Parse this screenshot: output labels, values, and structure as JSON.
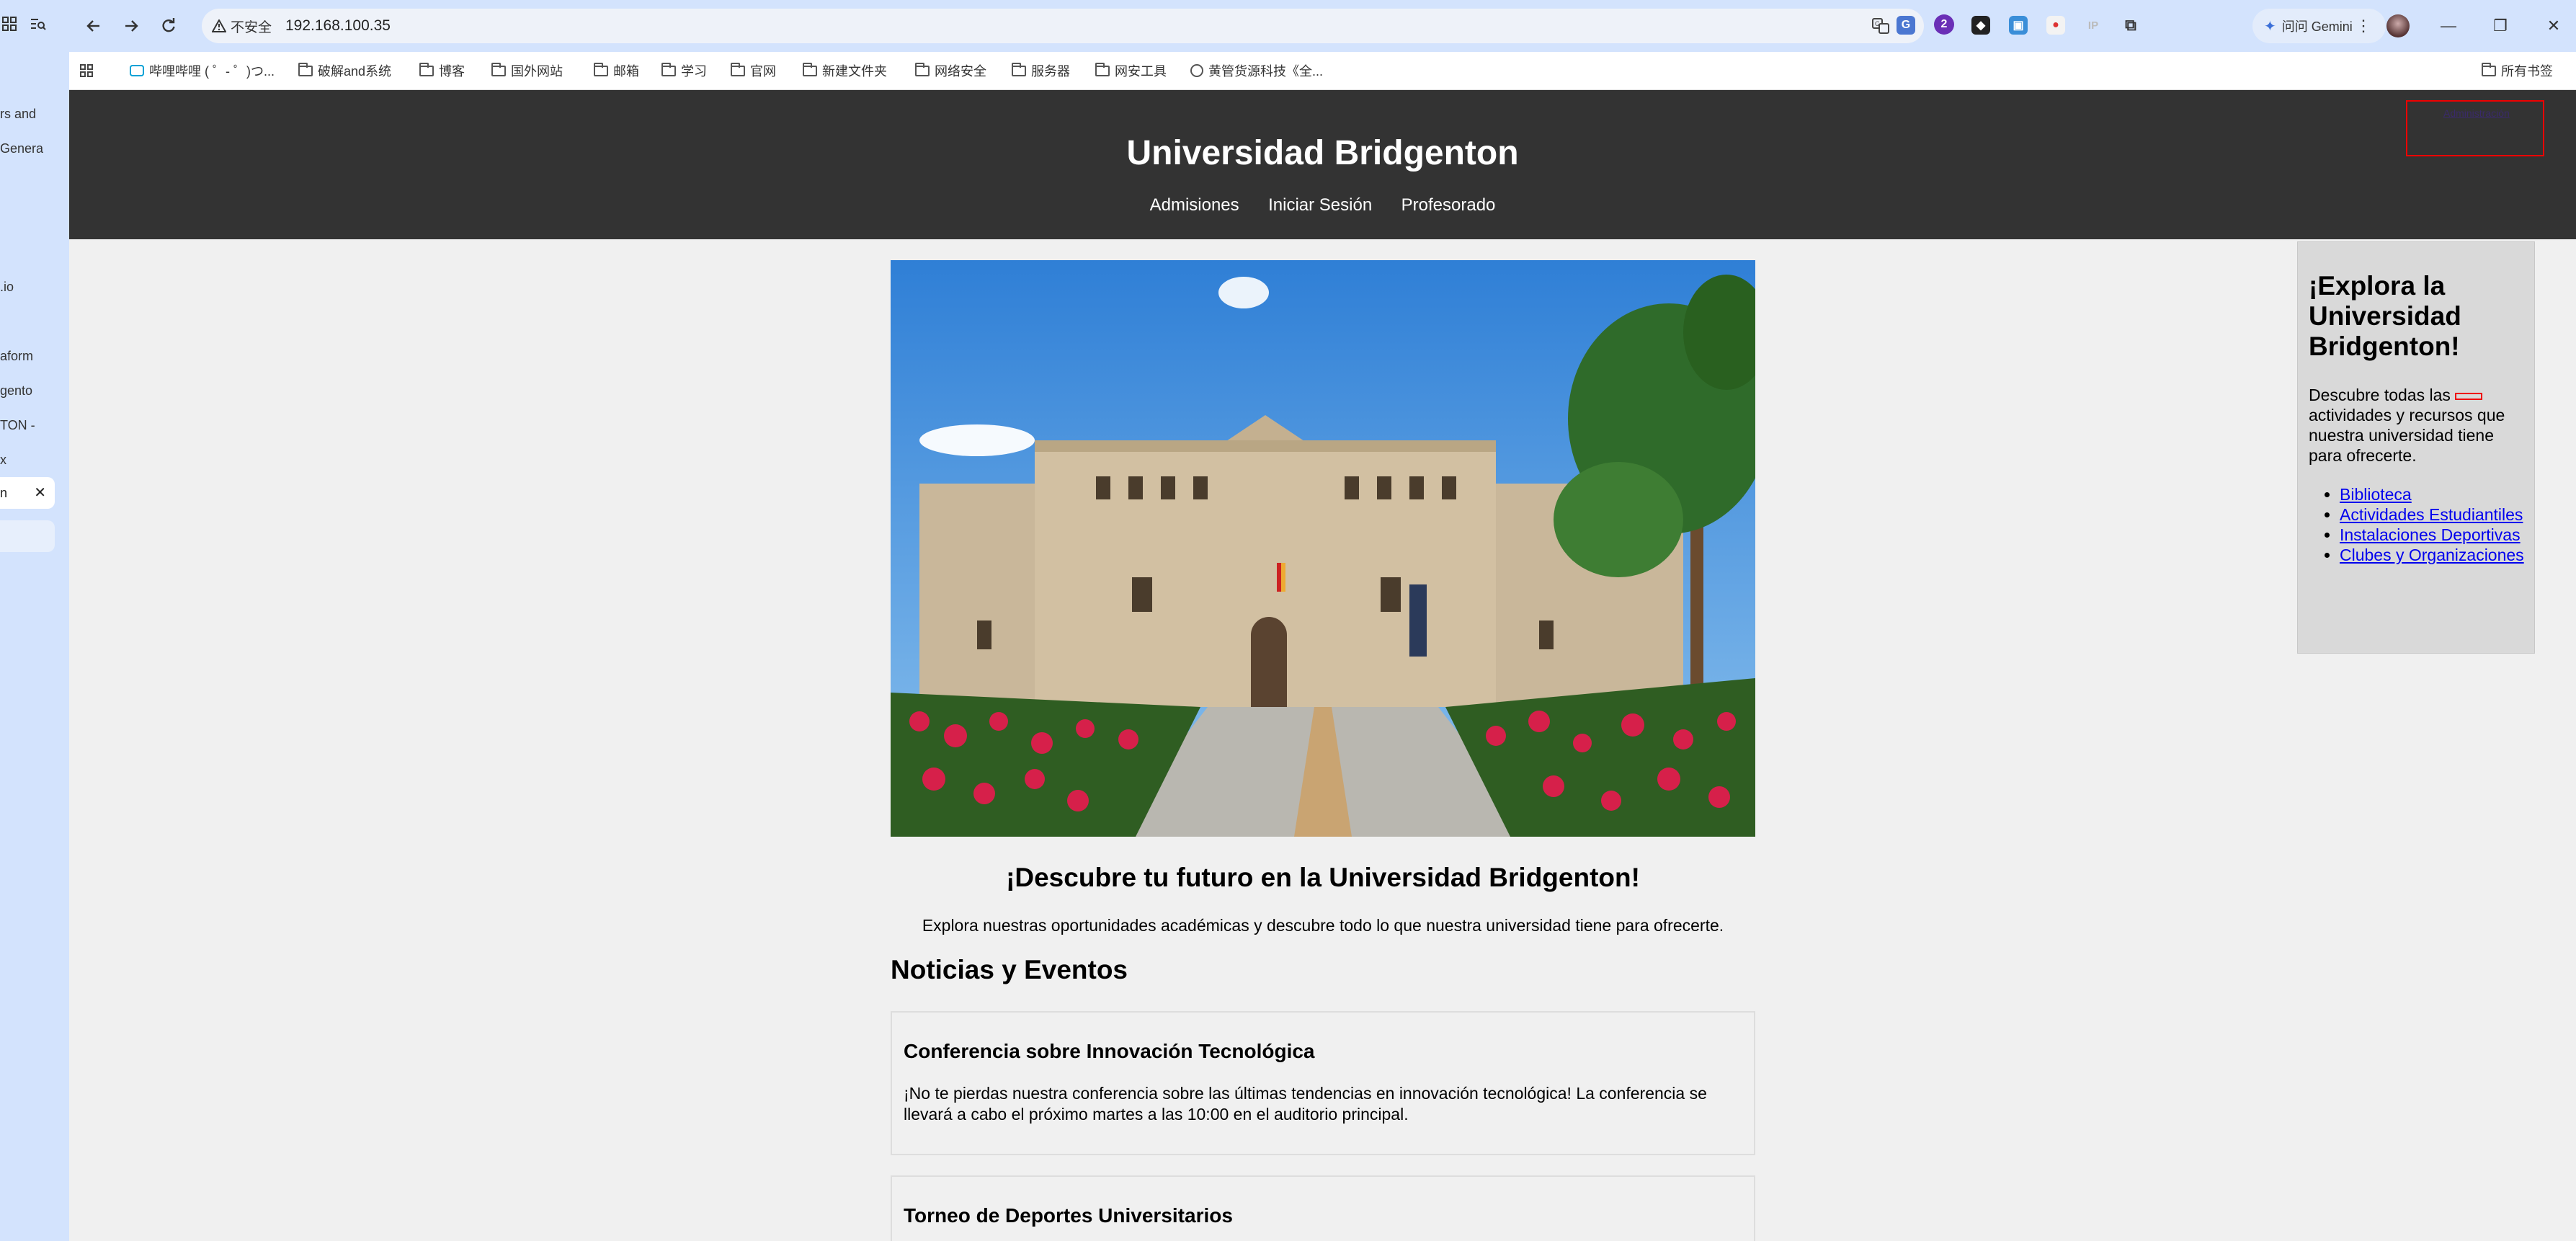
{
  "sidebar": {
    "tabs": [
      "rs and",
      "Genera",
      "",
      ".io",
      "aform",
      "gento",
      "TON -",
      "x"
    ],
    "active_tab": "n",
    "close_glyph": "✕"
  },
  "browser": {
    "security_label": "不安全",
    "url": "192.168.100.35",
    "gemini_label": "问问 Gemini",
    "ext_badge": "2"
  },
  "bookmarks": {
    "items": [
      "哔哩哔哩 ( ゜- ゜)つ...",
      "破解and系统",
      "博客",
      "国外网站",
      "邮箱",
      "学习",
      "官网",
      "新建文件夹",
      "网络安全",
      "服务器",
      "网安工具",
      "黄管货源科技《全..."
    ],
    "all_bookmarks": "所有书签"
  },
  "site": {
    "title": "Universidad Bridgenton",
    "nav": [
      "Admisiones",
      "Iniciar Sesión",
      "Profesorado"
    ],
    "hidden_link": "Administración",
    "headline": "¡Descubre tu futuro en la Universidad Bridgenton!",
    "tagline": "Explora nuestras oportunidades académicas y descubre todo lo que nuestra universidad tiene para ofrecerte.",
    "news_title": "Noticias y Eventos",
    "news": [
      {
        "title": "Conferencia sobre Innovación Tecnológica",
        "body": "¡No te pierdas nuestra conferencia sobre las últimas tendencias en innovación tecnológica! La conferencia se llevará a cabo el próximo martes a las 10:00 en el auditorio principal."
      },
      {
        "title": "Torneo de Deportes Universitarios",
        "body": ""
      }
    ],
    "aside": {
      "title": "¡Explora la Universidad Bridgenton!",
      "desc_before": "Descubre todas las",
      "desc_after": "actividades y recursos que nuestra universidad tiene para ofrecerte.",
      "links": [
        "Biblioteca",
        "Actividades Estudiantiles",
        "Instalaciones Deportivas",
        "Clubes y Organizaciones"
      ]
    }
  },
  "colors": {
    "header_bg": "#333333",
    "page_bg": "#f0f0f0",
    "chrome_bg": "#d3e3fd",
    "link": "#0000ee",
    "highlight_red": "#ee0000"
  }
}
